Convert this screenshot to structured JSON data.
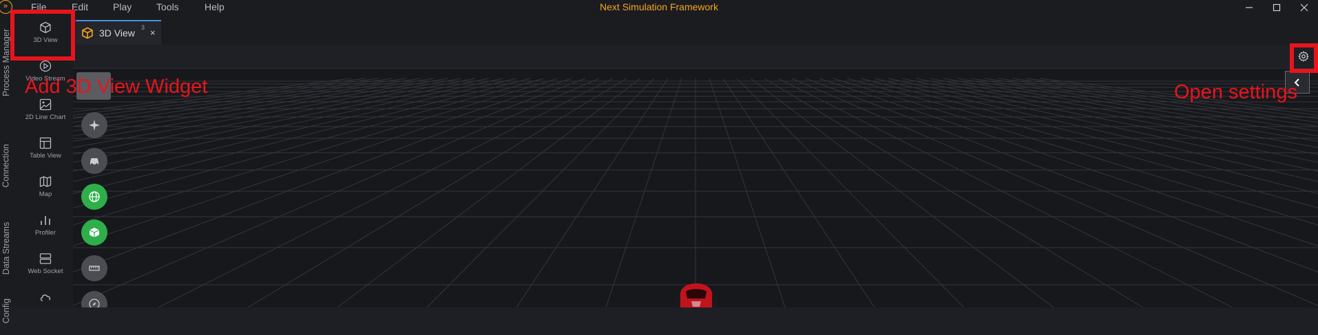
{
  "app": {
    "title": "Next Simulation Framework",
    "logo_glyph": "»",
    "accent": "#f5a623"
  },
  "menu": [
    "File",
    "Edit",
    "Play",
    "Tools",
    "Help"
  ],
  "window_controls": [
    "minimize-icon",
    "maximize-icon",
    "close-icon"
  ],
  "side_tabs": [
    "Process Manager",
    "Connection",
    "Data Streams",
    "Config"
  ],
  "palette": [
    {
      "label": "3D View",
      "icon": "cube-icon"
    },
    {
      "label": "Video Stream",
      "icon": "play-circle-icon"
    },
    {
      "label": "2D Line Chart",
      "icon": "image-icon"
    },
    {
      "label": "Table View",
      "icon": "table-icon"
    },
    {
      "label": "Map",
      "icon": "map-icon"
    },
    {
      "label": "Profiler",
      "icon": "bar-chart-icon"
    },
    {
      "label": "Web Socket",
      "icon": "server-icon"
    },
    {
      "label": "",
      "icon": "cloud-icon"
    }
  ],
  "tabs": [
    {
      "label": "3D View",
      "badge": "3",
      "close": "×",
      "icon": "cube-icon"
    }
  ],
  "viewport": {
    "tool_buttons": [
      {
        "icon": "airplane-icon",
        "active": false
      },
      {
        "icon": "car-icon",
        "active": false
      },
      {
        "icon": "globe-icon",
        "active": true
      },
      {
        "icon": "box-icon",
        "active": true
      },
      {
        "icon": "ruler-icon",
        "active": false
      },
      {
        "icon": "compass-icon",
        "active": false
      }
    ],
    "active_color": "#2eaf4a",
    "vehicle_color": "#c0141c"
  },
  "annotations": {
    "left_label": "Add 3D View Widget",
    "right_label": "Open settings",
    "color": "#e8141c"
  }
}
